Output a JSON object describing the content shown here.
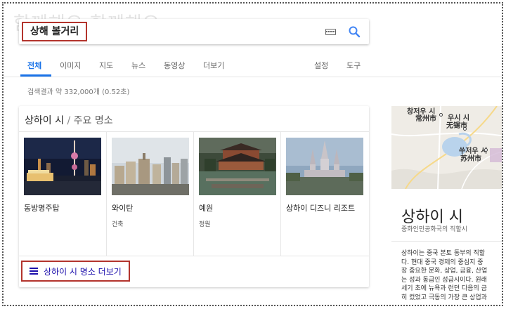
{
  "watermark": "함께해요 함께해요",
  "search": {
    "query": "상해 볼거리"
  },
  "tabs": [
    "전체",
    "이미지",
    "지도",
    "뉴스",
    "동영상",
    "더보기"
  ],
  "tools": [
    "설정",
    "도구"
  ],
  "stats": "검색결과 약 332,000개 (0.52초)",
  "card": {
    "title_city": "상하이 시",
    "title_sep": "/",
    "title_sub": "주요 명소",
    "places": [
      {
        "name": "동방명주탑",
        "type": ""
      },
      {
        "name": "와이탄",
        "type": "건축"
      },
      {
        "name": "예원",
        "type": "정원"
      },
      {
        "name": "상하이 디즈니 리조트",
        "type": ""
      }
    ],
    "more_label": "상하이 시 명소 더보기"
  },
  "knowledge_panel": {
    "map_labels": [
      "창저우 시",
      "常州市",
      "우시 시",
      "无锡市",
      "쑤저우 시",
      "苏州市"
    ],
    "title": "상하이 시",
    "subtitle": "중화인민공화국의 직할시",
    "description_lines": [
      "상하이는 중국 본토 동부의 직할",
      "다. 현대 중국 경제의 중심지 중",
      "장 중요한 문화, 상업, 금융, 산업",
      "는 성과 동급인 성급시이다. 원래",
      "세기 초에 뉴욕과 런던 다음의 금",
      "히 컸었고 극동의 가장 큰 상업과"
    ]
  },
  "colors": {
    "accent": "#1a73e8",
    "highlight_border": "#b3342d",
    "link": "#1a0dab"
  }
}
